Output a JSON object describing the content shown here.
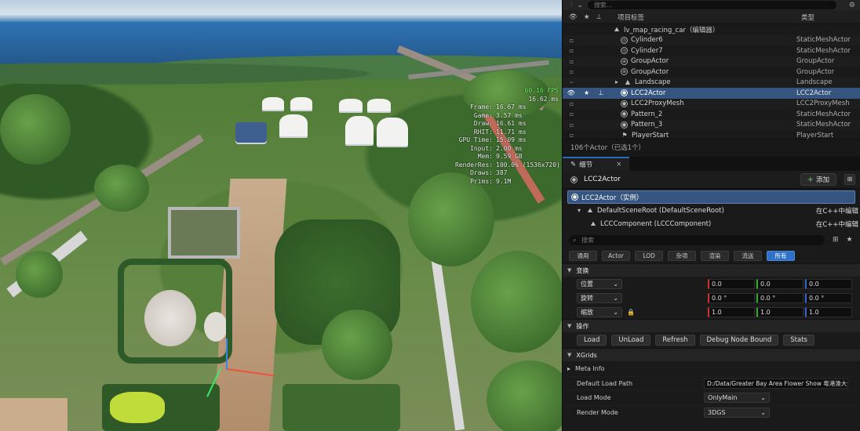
{
  "viewport": {
    "stats": {
      "fps": "60.16 FPS",
      "fps_ms": "16.62 ms",
      "rows": [
        {
          "k": "Frame:",
          "v": "16.67 ms"
        },
        {
          "k": "Game:",
          "v": "3.57 ms"
        },
        {
          "k": "Draw:",
          "v": "16.61 ms"
        },
        {
          "k": "RHIT:",
          "v": "11.71 ms"
        },
        {
          "k": "GPU Time:",
          "v": "15.09 ms"
        },
        {
          "k": "Input:",
          "v": "2.00 ms"
        },
        {
          "k": "Mem:",
          "v": "9.59 GB"
        },
        {
          "k": "RenderRes:",
          "v": "100.0% (1536x720)"
        },
        {
          "k": "Draws:",
          "v": "387"
        },
        {
          "k": "Prims:",
          "v": "9.1M"
        }
      ]
    }
  },
  "outliner": {
    "search_placeholder": "搜索...",
    "col_label": "项目标签",
    "col_type": "类型",
    "root": "lv_map_racing_car（编辑器）",
    "rows": [
      {
        "name": "Cylinder6",
        "type": "StaticMeshActor",
        "icon": "cylinder-icon"
      },
      {
        "name": "Cylinder7",
        "type": "StaticMeshActor",
        "icon": "cylinder-icon"
      },
      {
        "name": "GroupActor",
        "type": "GroupActor",
        "icon": "group-icon"
      },
      {
        "name": "GroupActor",
        "type": "GroupActor",
        "icon": "group-icon"
      },
      {
        "name": "Landscape",
        "type": "Landscape",
        "icon": "landscape-icon"
      },
      {
        "name": "LCC2Actor",
        "type": "LCC2Actor",
        "icon": "actor-icon",
        "selected": true
      },
      {
        "name": "LCC2ProxyMesh",
        "type": "LCC2ProxyMesh",
        "icon": "actor-icon"
      },
      {
        "name": "Pattern_2",
        "type": "StaticMeshActor",
        "icon": "actor-icon"
      },
      {
        "name": "Pattern_3",
        "type": "StaticMeshActor",
        "icon": "actor-icon"
      },
      {
        "name": "PlayerStart",
        "type": "PlayerStart",
        "icon": "player-start-icon"
      }
    ],
    "footer": "106个Actor（已选1个）"
  },
  "details": {
    "tab": "细节",
    "actor_name": "LCC2Actor",
    "add_label": "添加",
    "instance": "LCC2Actor（实例）",
    "components": [
      {
        "name": "DefaultSceneRoot (DefaultSceneRoot)",
        "edit": "在C++中编辑"
      },
      {
        "name": "LCCComponent (LCCComponent)",
        "edit": "在C++中编辑"
      }
    ],
    "search_placeholder": "搜索",
    "categories": [
      "通用",
      "Actor",
      "LOD",
      "杂项",
      "渲染",
      "流送",
      "所有"
    ],
    "active_category": "所有",
    "transform_section": "变换",
    "transform": [
      {
        "label": "位置",
        "x": "0.0",
        "y": "0.0",
        "z": "0.0"
      },
      {
        "label": "旋转",
        "x": "0.0 °",
        "y": "0.0 °",
        "z": "0.0 °"
      },
      {
        "label": "缩放",
        "x": "1.0",
        "y": "1.0",
        "z": "1.0"
      }
    ],
    "ops_section": "操作",
    "buttons": [
      "Load",
      "UnLoad",
      "Refresh",
      "Debug Node Bound",
      "Stats"
    ],
    "xgrids_section": "XGrids",
    "meta_section": "Meta Info",
    "props": [
      {
        "k": "Default Load Path",
        "v": "D:/Data/Greater Bay Area Flower Show 粤港澳大湾"
      },
      {
        "k": "Load Mode",
        "v": "OnlyMain"
      },
      {
        "k": "Render Mode",
        "v": "3DGS"
      }
    ]
  }
}
